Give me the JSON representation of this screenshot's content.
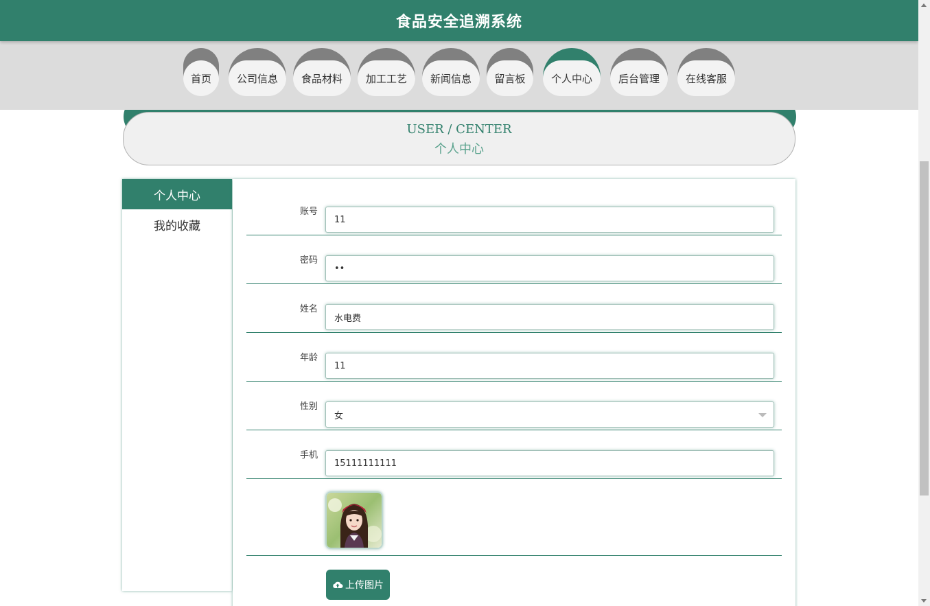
{
  "header": {
    "title": "食品安全追溯系统"
  },
  "nav": {
    "items": [
      {
        "label": "首页"
      },
      {
        "label": "公司信息"
      },
      {
        "label": "食品材料"
      },
      {
        "label": "加工工艺"
      },
      {
        "label": "新闻信息"
      },
      {
        "label": "留言板"
      },
      {
        "label": "个人中心"
      },
      {
        "label": "后台管理"
      },
      {
        "label": "在线客服"
      }
    ],
    "active": "个人中心"
  },
  "banner": {
    "en": "USER / CENTER",
    "cn": "个人中心"
  },
  "sidebar": {
    "items": [
      {
        "label": "个人中心"
      },
      {
        "label": "我的收藏"
      }
    ]
  },
  "form": {
    "account": {
      "label": "账号",
      "value": "11"
    },
    "password": {
      "label": "密码",
      "value": "11"
    },
    "name": {
      "label": "姓名",
      "value": "水电费"
    },
    "age": {
      "label": "年龄",
      "value": "11"
    },
    "gender": {
      "label": "性别",
      "value": "女"
    },
    "phone": {
      "label": "手机",
      "value": "15111111111"
    },
    "upload_label": "上传图片"
  },
  "colors": {
    "primary": "#31806c",
    "nav_bg": "#dcdcdc",
    "nav_cap": "#808080"
  },
  "icons": {
    "upload": "cloud-upload-icon"
  }
}
